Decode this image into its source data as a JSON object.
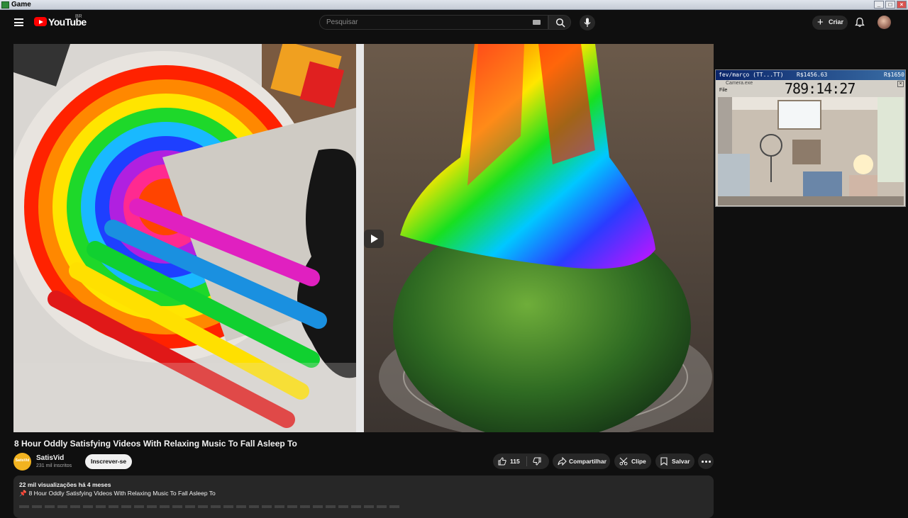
{
  "window": {
    "title": "Game",
    "buttons": [
      "_",
      "□",
      "×"
    ]
  },
  "header": {
    "logo_text": "YouTube",
    "country": "BR",
    "search_placeholder": "Pesquisar",
    "create_label": "Criar",
    "icons": [
      "menu-icon",
      "youtube-logo-icon",
      "keyboard-icon",
      "search-icon",
      "mic-icon",
      "plus-icon",
      "bell-icon"
    ]
  },
  "video": {
    "title": "8 Hour Oddly Satisfying Videos With Relaxing Music To Fall Asleep To",
    "channel": {
      "name": "SatisVid",
      "subscribers": "231 mil inscritos",
      "avatar_text": "SatisVid"
    },
    "subscribe_label": "Inscrever-se",
    "likes": "115",
    "share_label": "Compartilhar",
    "clip_label": "Clipe",
    "save_label": "Salvar",
    "views_meta": "22 mil visualizações  há 4 meses",
    "description_line": "8 Hour Oddly Satisfying Videos With Relaxing Music To Fall Asleep To",
    "description_pin": "📌"
  },
  "overlay": {
    "period": "fev/março (TT...TT)",
    "balance": "R$1456.63",
    "balance_right": "R$1650",
    "window_title": "Camera.exe",
    "menu": "File",
    "timer": "789:14:27"
  },
  "colors": {
    "accent": "#ff0000",
    "background": "#0f0f0f",
    "pill": "#272727",
    "channel_avatar": "#f2b320"
  }
}
